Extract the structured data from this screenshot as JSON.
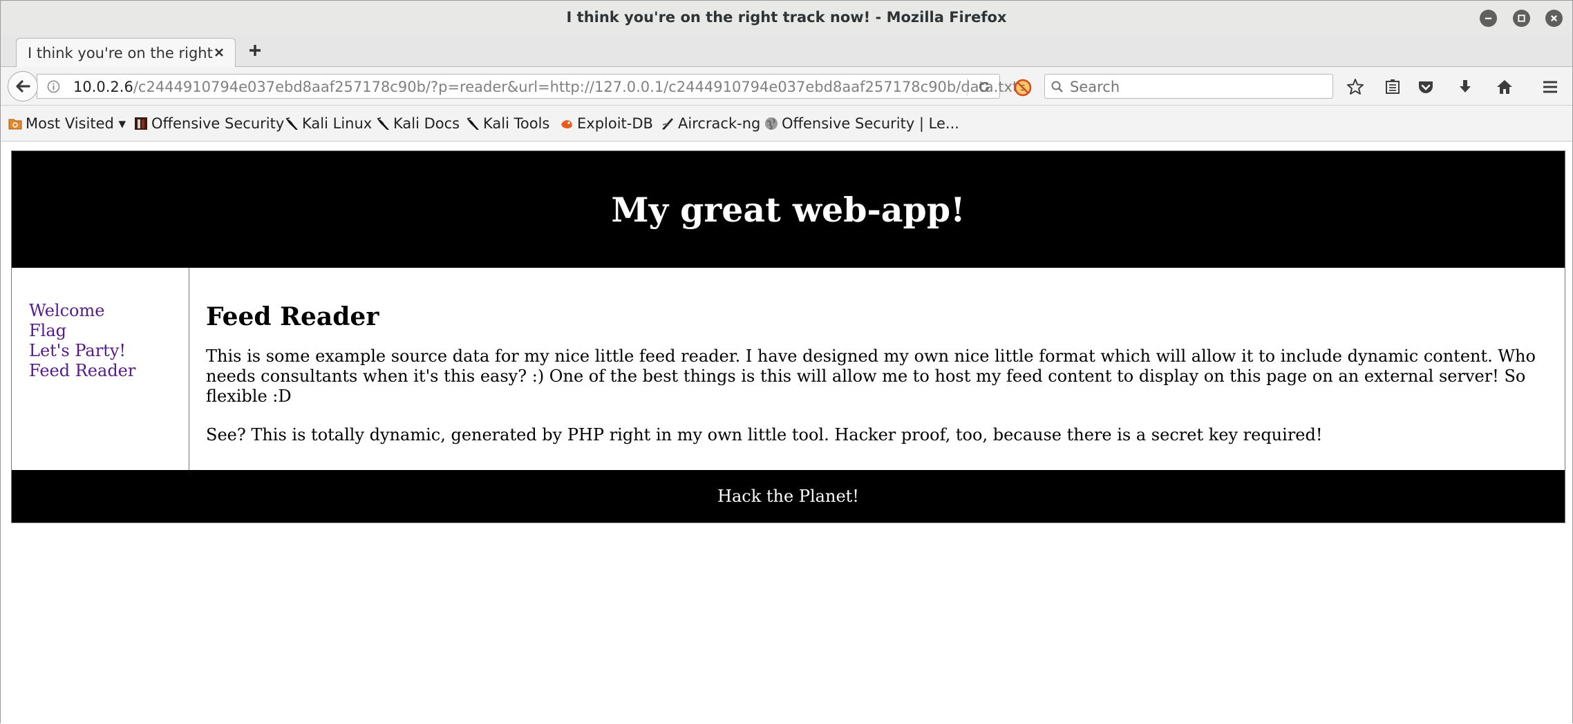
{
  "window": {
    "title": "I think you're on the right track now! - Mozilla Firefox"
  },
  "tab": {
    "title": "I think you're on the right ..."
  },
  "urlbar": {
    "host": "10.0.2.6",
    "path": "/c2444910794e037ebd8aaf257178c90b/?p=reader&url=http://127.0.0.1/c2444910794e037ebd8aaf257178c90b/data.txt"
  },
  "search": {
    "placeholder": "Search"
  },
  "bookmarks": [
    {
      "label": "Most Visited ▾",
      "icon": "folder-icon"
    },
    {
      "label": "Offensive Security",
      "icon": "offsec-icon"
    },
    {
      "label": "Kali Linux",
      "icon": "kali-dragon-icon"
    },
    {
      "label": "Kali Docs",
      "icon": "kali-dragon-icon"
    },
    {
      "label": "Kali Tools",
      "icon": "kali-dragon-icon"
    },
    {
      "label": "Exploit-DB",
      "icon": "exploitdb-icon"
    },
    {
      "label": "Aircrack-ng",
      "icon": "aircrack-icon"
    },
    {
      "label": "Offensive Security | Le...",
      "icon": "globe-icon"
    }
  ],
  "app": {
    "heading": "My great web-app!",
    "nav": {
      "welcome": "Welcome",
      "flag": "Flag",
      "party": "Let's Party!",
      "reader": "Feed Reader"
    },
    "main": {
      "title": "Feed Reader",
      "paragraph1": "This is some example source data for my nice little feed reader. I have designed my own nice little format which will allow it to include dynamic content. Who needs consultants when it's this easy? :) One of the best things is this will allow me to host my feed content to display on this page on an external server! So flexible :D",
      "paragraph2": "See? This is totally dynamic, generated by PHP right in my own little tool. Hacker proof, too, because there is a secret key required!"
    },
    "footer": "Hack the Planet!"
  }
}
